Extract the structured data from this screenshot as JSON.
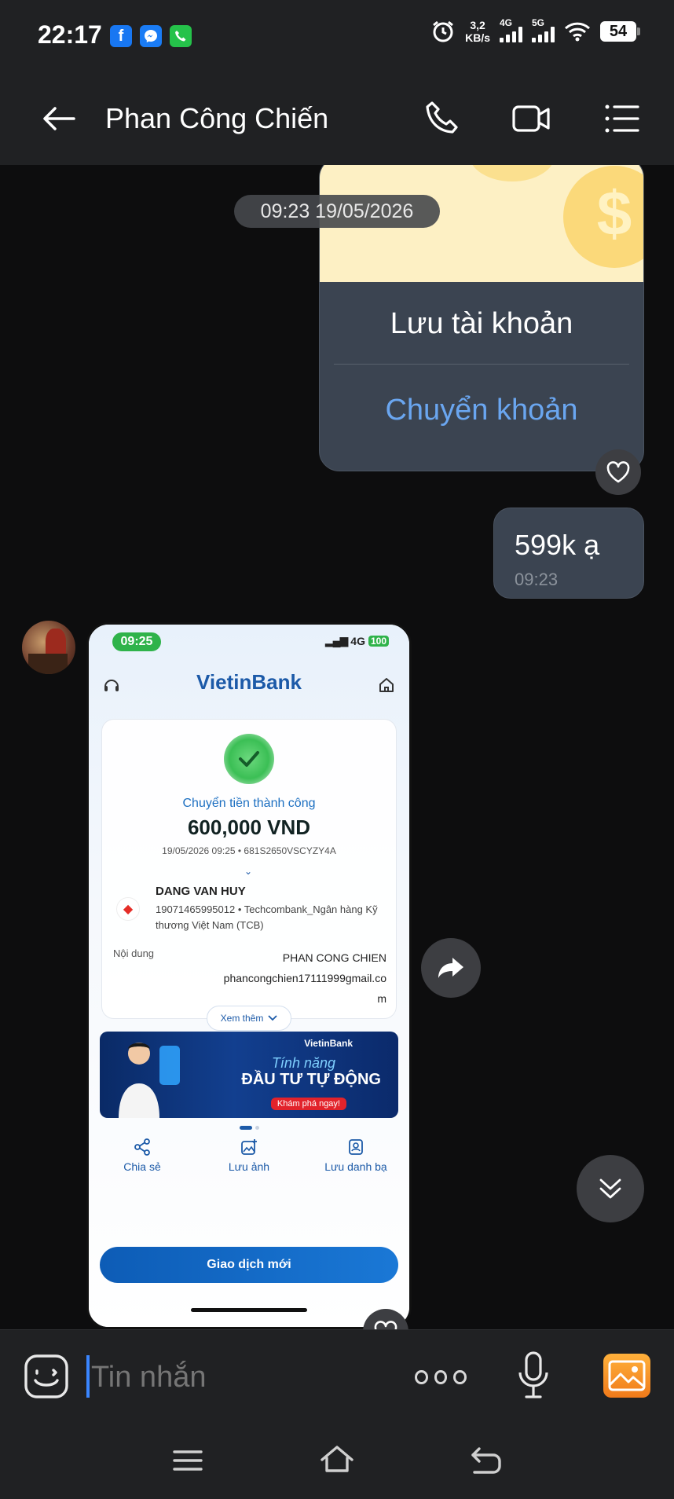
{
  "status_bar": {
    "time": "22:17",
    "net_speed_value": "3,2",
    "net_speed_unit": "KB/s",
    "signal1_label": "4G",
    "signal2_label": "5G",
    "battery": "54"
  },
  "header": {
    "title": "Phan Công Chiến"
  },
  "card": {
    "save_label": "Lưu tài khoản",
    "transfer_label": "Chuyển khoản"
  },
  "timestamp_pill": "09:23 19/05/2026",
  "bubble": {
    "text": "599k ạ",
    "time": "09:23"
  },
  "screenshot": {
    "time": "09:25",
    "network": "4G",
    "battery": "100",
    "bank_logo": "VietinBank",
    "success_text": "Chuyển tiền thành công",
    "amount": "600,000 VND",
    "meta": "19/05/2026 09:25 • 681S2650VSCYZY4A",
    "recipient_name": "DANG VAN HUY",
    "recipient_account": "19071465995012 • Techcombank_Ngân hàng Kỹ thương Việt Nam (TCB)",
    "content_label": "Nội dung",
    "content_value_line1": "PHAN CONG CHIEN",
    "content_value_line2": "phancongchien17111999gmail.co",
    "content_value_line3": "m",
    "see_more": "Xem thêm",
    "banner_brand": "VietinBank",
    "banner_title1": "Tính năng",
    "banner_title2": "ĐẦU TƯ TỰ ĐỘNG",
    "banner_button": "Khám phá ngay!",
    "action_share": "Chia sẻ",
    "action_save_image": "Lưu ảnh",
    "action_save_contact": "Lưu danh bạ",
    "new_transaction": "Giao dịch mới"
  },
  "input": {
    "placeholder": "Tin nhắn"
  },
  "colors": {
    "background": "#0d0d0e",
    "bar": "#202123",
    "bubble": "#3b4451",
    "accent_blue": "#6aa6f0"
  }
}
